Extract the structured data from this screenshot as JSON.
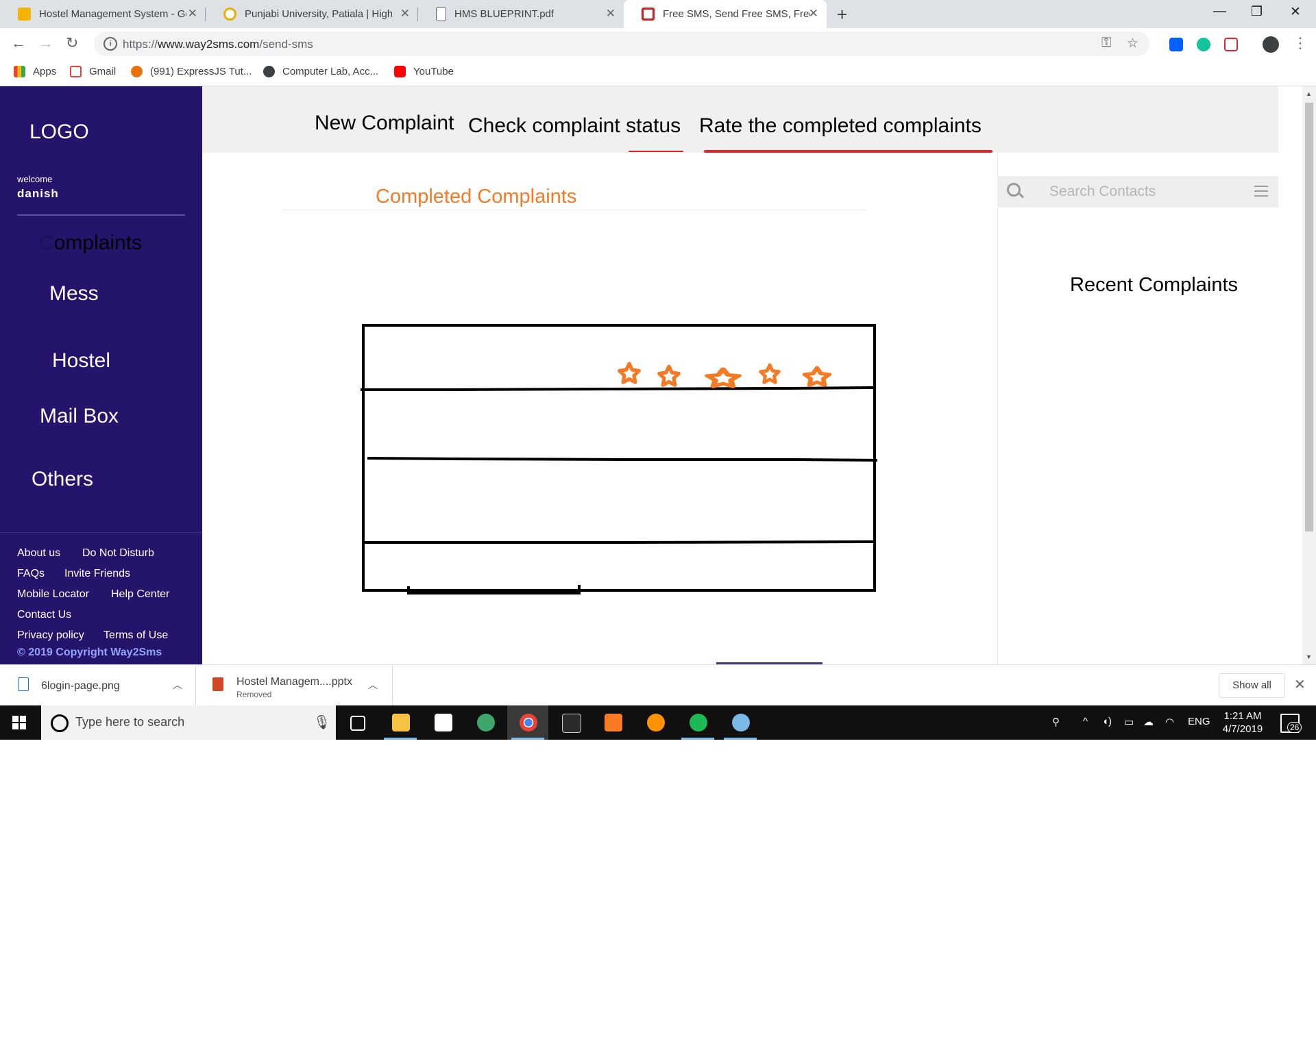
{
  "browser": {
    "tabs": [
      {
        "title": "Hostel Management System - Go",
        "favicon_color": "#f4b400"
      },
      {
        "title": "Punjabi University, Patiala | Highe",
        "favicon_color": "#e8b000"
      },
      {
        "title": "HMS BLUEPRINT.pdf",
        "favicon_color": "#5f6368"
      },
      {
        "title": "Free SMS, Send Free SMS, Free S",
        "favicon_color": "#c5221f"
      }
    ],
    "url_prefix": "https://",
    "url_main": "www.way2sms.com",
    "url_path": "/send-sms",
    "bookmarks": [
      "Apps",
      "Gmail",
      "(991) ExpressJS Tut...",
      "Computer Lab, Acc...",
      "YouTube"
    ]
  },
  "sidebar": {
    "logo": "LOGO",
    "welcome": "welcome",
    "username": "danish",
    "menu": {
      "complaints_first": "C",
      "complaints_rest": "omplaints",
      "mess": "Mess",
      "hostel": "Hostel",
      "mailbox": "Mail Box",
      "others": "Others"
    },
    "footer_links": [
      "About us",
      "Do Not Disturb",
      "FAQs",
      "Invite Friends",
      "Mobile Locator",
      "Help Center",
      "Contact Us",
      "Privacy policy",
      "Terms of Use"
    ],
    "copyright": "© 2019 Copyright Way2Sms"
  },
  "topnav": {
    "new_complaint": "New Complaint",
    "check_status": "Check complaint status",
    "rate_completed": "Rate the completed complaints"
  },
  "main": {
    "title": "Completed Complaints",
    "sketch": {
      "rows": 4,
      "stars": 5,
      "star_color": "#f47b25"
    }
  },
  "right_panel": {
    "search_placeholder": "Search Contacts",
    "recent_title": "Recent Complaints"
  },
  "downloads": {
    "items": [
      {
        "name": "6login-page.png",
        "status": ""
      },
      {
        "name": "Hostel Managem....pptx",
        "status": "Removed"
      }
    ],
    "show_all": "Show all"
  },
  "taskbar": {
    "search_placeholder": "Type here to search",
    "language": "ENG",
    "time": "1:21 AM",
    "date": "4/7/2019",
    "notifications": "26"
  },
  "colors": {
    "sidebar_bg": "#24146b",
    "accent_orange": "#f47b25",
    "active_red": "#e3262d"
  }
}
